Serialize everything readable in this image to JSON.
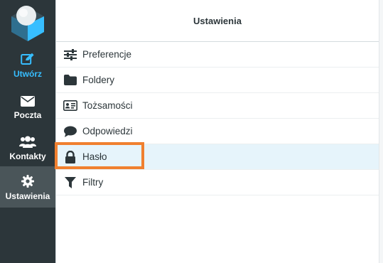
{
  "nav": {
    "compose_label": "Utwórz",
    "mail_label": "Poczta",
    "contacts_label": "Kontakty",
    "settings_label": "Ustawienia"
  },
  "panel": {
    "title": "Ustawienia",
    "items": [
      {
        "label": "Preferencje",
        "icon": "sliders-icon"
      },
      {
        "label": "Foldery",
        "icon": "folder-icon"
      },
      {
        "label": "Tożsamości",
        "icon": "id-card-icon"
      },
      {
        "label": "Odpowiedzi",
        "icon": "comment-icon"
      },
      {
        "label": "Hasło",
        "icon": "lock-icon",
        "selected": true
      },
      {
        "label": "Filtry",
        "icon": "filter-icon"
      }
    ]
  },
  "colors": {
    "rail_bg": "#2c363a",
    "accent": "#37beff",
    "selected_bg": "#e6f4fb",
    "highlight": "#f0802f"
  }
}
